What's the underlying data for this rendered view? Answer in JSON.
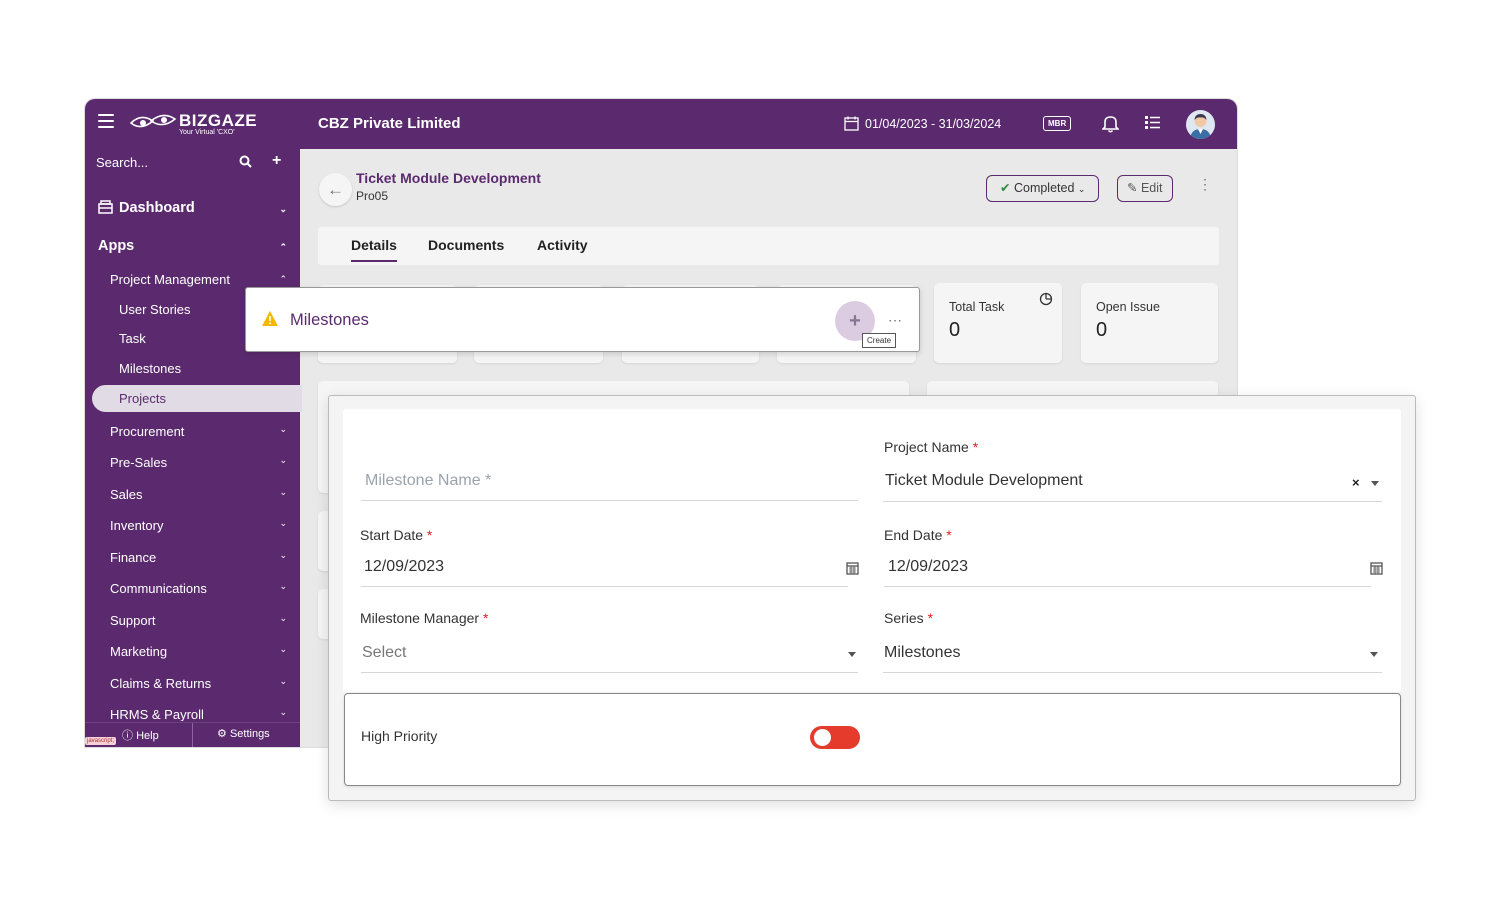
{
  "header": {
    "brand": "BIZGAZE",
    "brand_tag": "Your Virtual 'CXO'",
    "company": "CBZ Private Limited",
    "date_range": "01/04/2023 - 31/03/2024",
    "mbr_badge": "MBR"
  },
  "sidebar": {
    "search_placeholder": "Search...",
    "items": [
      {
        "label": "Dashboard"
      },
      {
        "label": "Apps"
      },
      {
        "label": "Project Management"
      },
      {
        "label": "User Stories"
      },
      {
        "label": "Task"
      },
      {
        "label": "Milestones"
      },
      {
        "label": "Projects"
      },
      {
        "label": "Procurement"
      },
      {
        "label": "Pre-Sales"
      },
      {
        "label": "Sales"
      },
      {
        "label": "Inventory"
      },
      {
        "label": "Finance"
      },
      {
        "label": "Communications"
      },
      {
        "label": "Support"
      },
      {
        "label": "Marketing"
      },
      {
        "label": "Claims & Returns"
      },
      {
        "label": "HRMS & Payroll"
      }
    ],
    "footer": {
      "help": "Help",
      "settings": "Settings",
      "js_label": "javascript;"
    }
  },
  "main": {
    "title": "Ticket Module Development",
    "subtitle": "Pro05",
    "status": "Completed",
    "edit": "Edit",
    "tabs": [
      {
        "label": "Details"
      },
      {
        "label": "Documents"
      },
      {
        "label": "Activity"
      }
    ],
    "stats": [
      {
        "label": "Total Task",
        "value": "0"
      },
      {
        "label": "Open Issue",
        "value": "0"
      }
    ]
  },
  "milestones_popup": {
    "title": "Milestones",
    "create_tooltip": "Create"
  },
  "form": {
    "milestone_name": {
      "placeholder": "Milestone Name *"
    },
    "project_name": {
      "label": "Project Name",
      "value": "Ticket Module Development"
    },
    "start_date": {
      "label": "Start Date",
      "value": "12/09/2023"
    },
    "end_date": {
      "label": "End Date",
      "value": "12/09/2023"
    },
    "milestone_manager": {
      "label": "Milestone Manager",
      "value": "Select"
    },
    "series": {
      "label": "Series",
      "value": "Milestones"
    },
    "high_priority": {
      "label": "High Priority",
      "enabled": false
    },
    "required_mark": "*"
  },
  "colors": {
    "brand_purple": "#5b2a6e",
    "toggle_off_red": "#e53b2c",
    "required_red": "#e02020"
  }
}
